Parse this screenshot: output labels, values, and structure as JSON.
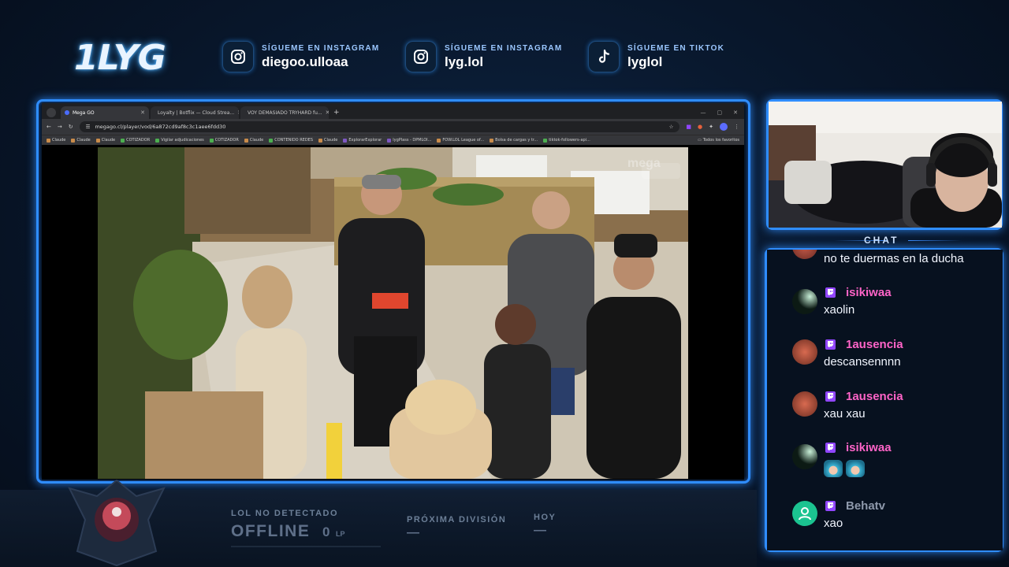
{
  "header": {
    "logo": "1LYG",
    "socials": [
      {
        "icon": "instagram-icon",
        "label": "SÍGUEME EN INSTAGRAM",
        "handle": "diegoo.ulloaa"
      },
      {
        "icon": "instagram-icon",
        "label": "SÍGUEME EN INSTAGRAM",
        "handle": "lyg.lol"
      },
      {
        "icon": "tiktok-icon",
        "label": "SÍGUEME EN TIKTOK",
        "handle": "lyglol"
      }
    ]
  },
  "browser": {
    "tabs": [
      {
        "title": "Mega GO",
        "active": true
      },
      {
        "title": "Loyalty | Botflix — Cloud Strea...",
        "active": false
      },
      {
        "title": "VOY DEMASIADO TRYHARD fu...",
        "active": false
      }
    ],
    "url": "megago.cl/player/vod/6a872cd9af8c3c1aee6fdd30",
    "bookmarks": [
      "Claude",
      "Claude",
      "Claude",
      "COTIZADOR",
      "Vigilar adjudicaciones",
      "COTIZADOR",
      "Claude",
      "CONTENIDO REDES",
      "Claude",
      "ExplorarExplorar",
      "lygPlass - DPMLOI...",
      "FOW.LOL League of...",
      "Bolsa de cargas y tr...",
      "tiktok-followers-api..."
    ],
    "all_bookmarks": "Todos los favoritos",
    "watermark": "mega"
  },
  "chat": {
    "title": "CHAT",
    "messages": [
      {
        "user": "",
        "text": "no te duermas en la ducha",
        "avatar": "avatar-red"
      },
      {
        "user": "isikiwaa",
        "text": "xaolin",
        "avatar": "avatar-dark"
      },
      {
        "user": "1ausencia",
        "text": "descansennnn",
        "avatar": "avatar-red"
      },
      {
        "user": "1ausencia",
        "text": "xau xau",
        "avatar": "avatar-red"
      },
      {
        "user": "isikiwaa",
        "text": "",
        "avatar": "avatar-dark",
        "emotes": 2
      },
      {
        "user": "Behatv",
        "text": "xao",
        "avatar": "avatar-default"
      }
    ]
  },
  "footer": {
    "status_label": "LOL NO DETECTADO",
    "status": "OFFLINE",
    "lp_value": "0",
    "lp_unit": "LP",
    "next_division_label": "PRÓXIMA DIVISIÓN",
    "next_division_value": "—",
    "today_label": "HOY",
    "today_value": "—"
  },
  "colors": {
    "accent": "#2f8dff",
    "username": "#ff64c8",
    "twitch": "#9146ff"
  }
}
